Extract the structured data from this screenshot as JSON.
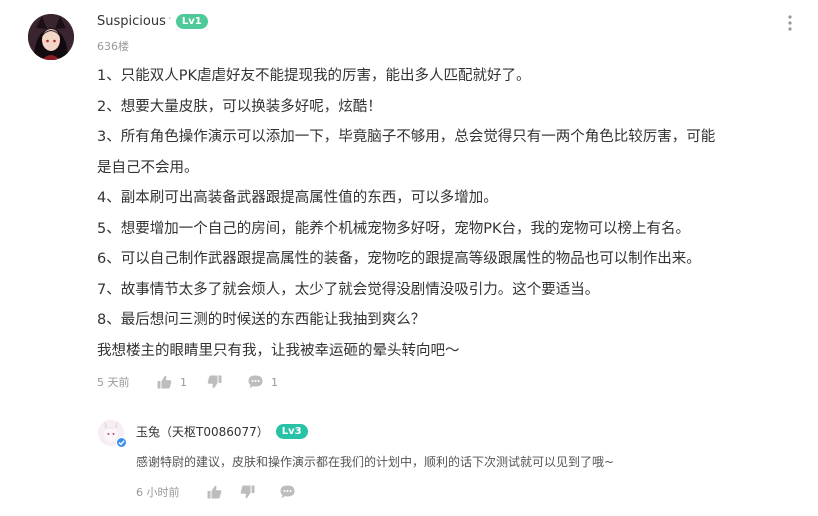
{
  "comment": {
    "author": "Suspicious",
    "author_mark": "′",
    "level": "Lv1",
    "floor": "636楼",
    "lines": [
      "1、只能双人PK虐虐好友不能提现我的厉害，能出多人匹配就好了。",
      "2、想要大量皮肤，可以换装多好呢，炫酷！",
      "3、所有角色操作演示可以添加一下，毕竟脑子不够用，总会觉得只有一两个角色比较厉害，可能",
      "是自己不会用。",
      "4、副本刷可出高装备武器跟提高属性值的东西，可以多增加。",
      "5、想要增加一个自己的房间，能养个机械宠物多好呀，宠物PK台，我的宠物可以榜上有名。",
      "6、可以自己制作武器跟提高属性的装备，宠物吃的跟提高等级跟属性的物品也可以制作出来。",
      "7、故事情节太多了就会烦人，太少了就会觉得没剧情没吸引力。这个要适当。",
      "8、最后想问三测的时候送的东西能让我抽到爽么？",
      "我想楼主的眼睛里只有我，让我被幸运砸的晕头转向吧～"
    ],
    "time": "5 天前",
    "like_count": "1",
    "reply_count": "1"
  },
  "reply": {
    "author": "玉兔（天枢T0086077）",
    "level": "Lv3",
    "text": "感谢特尉的建议，皮肤和操作演示都在我们的计划中，顺利的话下次测试就可以见到了哦~",
    "time": "6 小时前"
  },
  "icons": {
    "like": "thumbs-up-icon",
    "dislike": "thumbs-down-icon",
    "comment": "comment-bubble-icon",
    "more": "more-vertical-icon",
    "verified": "verified-check-icon"
  },
  "colors": {
    "lv1_badge": "#4ec99a",
    "lv3_badge": "#28c3a6",
    "icon_gray": "#bdbdbd",
    "verified_blue": "#3b8ff0"
  }
}
